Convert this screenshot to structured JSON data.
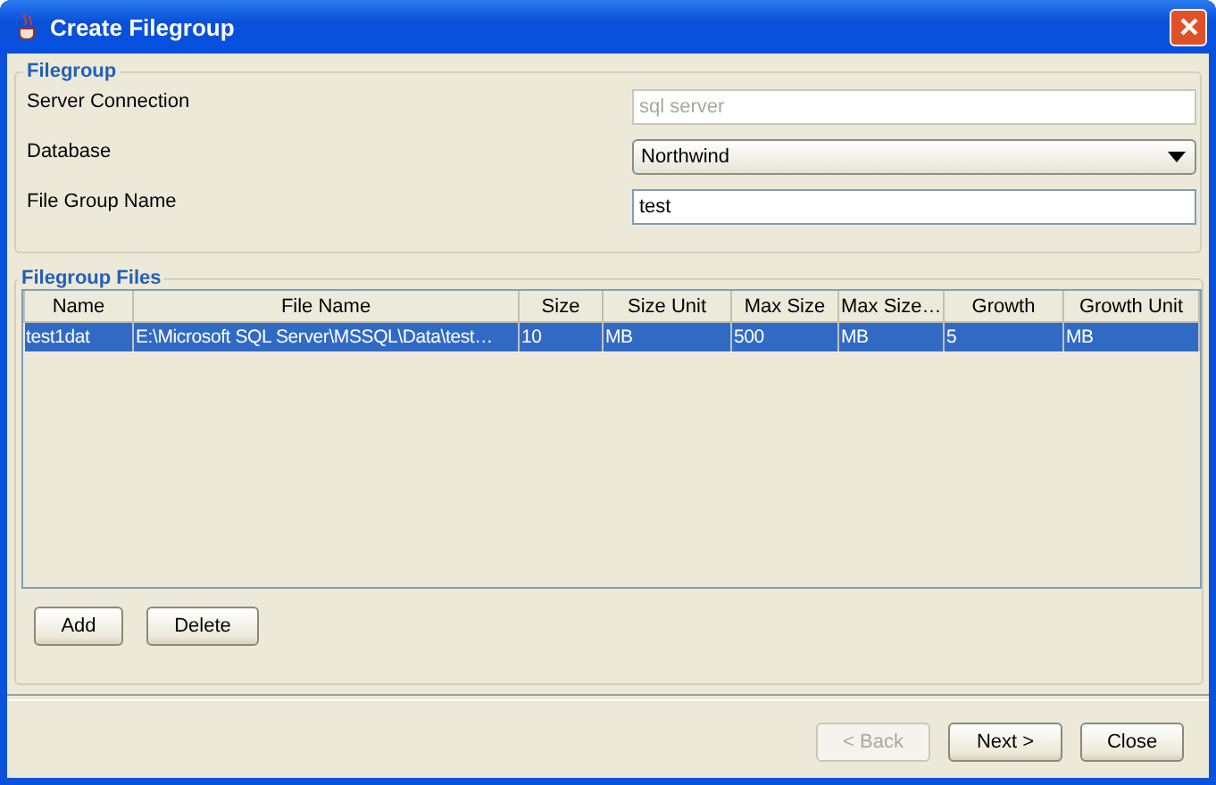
{
  "window": {
    "title": "Create Filegroup"
  },
  "filegroup": {
    "legend": "Filegroup",
    "fields": [
      {
        "kind": "text",
        "label": "Server Connection",
        "value": "sql server",
        "disabled": true
      },
      {
        "kind": "select",
        "label": "Database",
        "value": "Northwind",
        "disabled": false
      },
      {
        "kind": "text",
        "label": "File Group Name",
        "value": "test",
        "disabled": false
      }
    ]
  },
  "files": {
    "legend": "Filegroup Files",
    "columns": [
      "Name",
      "File Name",
      "Size",
      "Size Unit",
      "Max Size",
      "Max Size…",
      "Growth",
      "Growth Unit"
    ],
    "rows": [
      {
        "selected": true,
        "cells": [
          "test1dat",
          "E:\\Microsoft SQL Server\\MSSQL\\Data\\test…",
          "10",
          "MB",
          "500",
          "MB",
          "5",
          "MB"
        ]
      }
    ],
    "buttons": [
      "Add",
      "Delete"
    ]
  },
  "footer_buttons": [
    {
      "label": "< Back",
      "disabled": true
    },
    {
      "label": "Next >",
      "disabled": false
    },
    {
      "label": "Close",
      "disabled": false
    }
  ]
}
